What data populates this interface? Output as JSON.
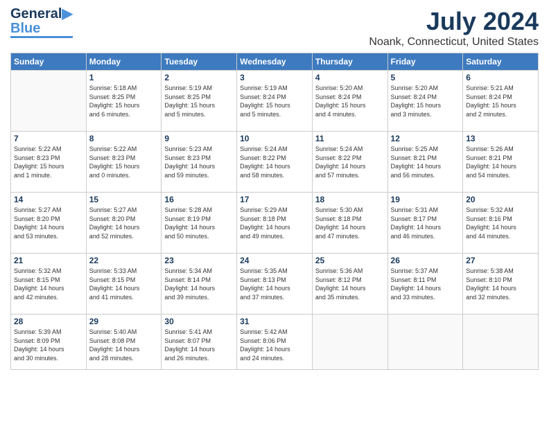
{
  "header": {
    "logo_line1": "General",
    "logo_line2": "Blue",
    "main_title": "July 2024",
    "subtitle": "Noank, Connecticut, United States"
  },
  "calendar": {
    "days_of_week": [
      "Sunday",
      "Monday",
      "Tuesday",
      "Wednesday",
      "Thursday",
      "Friday",
      "Saturday"
    ],
    "weeks": [
      [
        {
          "day": "",
          "info": ""
        },
        {
          "day": "1",
          "info": "Sunrise: 5:18 AM\nSunset: 8:25 PM\nDaylight: 15 hours\nand 6 minutes."
        },
        {
          "day": "2",
          "info": "Sunrise: 5:19 AM\nSunset: 8:25 PM\nDaylight: 15 hours\nand 5 minutes."
        },
        {
          "day": "3",
          "info": "Sunrise: 5:19 AM\nSunset: 8:24 PM\nDaylight: 15 hours\nand 5 minutes."
        },
        {
          "day": "4",
          "info": "Sunrise: 5:20 AM\nSunset: 8:24 PM\nDaylight: 15 hours\nand 4 minutes."
        },
        {
          "day": "5",
          "info": "Sunrise: 5:20 AM\nSunset: 8:24 PM\nDaylight: 15 hours\nand 3 minutes."
        },
        {
          "day": "6",
          "info": "Sunrise: 5:21 AM\nSunset: 8:24 PM\nDaylight: 15 hours\nand 2 minutes."
        }
      ],
      [
        {
          "day": "7",
          "info": "Sunrise: 5:22 AM\nSunset: 8:23 PM\nDaylight: 15 hours\nand 1 minute."
        },
        {
          "day": "8",
          "info": "Sunrise: 5:22 AM\nSunset: 8:23 PM\nDaylight: 15 hours\nand 0 minutes."
        },
        {
          "day": "9",
          "info": "Sunrise: 5:23 AM\nSunset: 8:23 PM\nDaylight: 14 hours\nand 59 minutes."
        },
        {
          "day": "10",
          "info": "Sunrise: 5:24 AM\nSunset: 8:22 PM\nDaylight: 14 hours\nand 58 minutes."
        },
        {
          "day": "11",
          "info": "Sunrise: 5:24 AM\nSunset: 8:22 PM\nDaylight: 14 hours\nand 57 minutes."
        },
        {
          "day": "12",
          "info": "Sunrise: 5:25 AM\nSunset: 8:21 PM\nDaylight: 14 hours\nand 56 minutes."
        },
        {
          "day": "13",
          "info": "Sunrise: 5:26 AM\nSunset: 8:21 PM\nDaylight: 14 hours\nand 54 minutes."
        }
      ],
      [
        {
          "day": "14",
          "info": "Sunrise: 5:27 AM\nSunset: 8:20 PM\nDaylight: 14 hours\nand 53 minutes."
        },
        {
          "day": "15",
          "info": "Sunrise: 5:27 AM\nSunset: 8:20 PM\nDaylight: 14 hours\nand 52 minutes."
        },
        {
          "day": "16",
          "info": "Sunrise: 5:28 AM\nSunset: 8:19 PM\nDaylight: 14 hours\nand 50 minutes."
        },
        {
          "day": "17",
          "info": "Sunrise: 5:29 AM\nSunset: 8:18 PM\nDaylight: 14 hours\nand 49 minutes."
        },
        {
          "day": "18",
          "info": "Sunrise: 5:30 AM\nSunset: 8:18 PM\nDaylight: 14 hours\nand 47 minutes."
        },
        {
          "day": "19",
          "info": "Sunrise: 5:31 AM\nSunset: 8:17 PM\nDaylight: 14 hours\nand 46 minutes."
        },
        {
          "day": "20",
          "info": "Sunrise: 5:32 AM\nSunset: 8:16 PM\nDaylight: 14 hours\nand 44 minutes."
        }
      ],
      [
        {
          "day": "21",
          "info": "Sunrise: 5:32 AM\nSunset: 8:15 PM\nDaylight: 14 hours\nand 42 minutes."
        },
        {
          "day": "22",
          "info": "Sunrise: 5:33 AM\nSunset: 8:15 PM\nDaylight: 14 hours\nand 41 minutes."
        },
        {
          "day": "23",
          "info": "Sunrise: 5:34 AM\nSunset: 8:14 PM\nDaylight: 14 hours\nand 39 minutes."
        },
        {
          "day": "24",
          "info": "Sunrise: 5:35 AM\nSunset: 8:13 PM\nDaylight: 14 hours\nand 37 minutes."
        },
        {
          "day": "25",
          "info": "Sunrise: 5:36 AM\nSunset: 8:12 PM\nDaylight: 14 hours\nand 35 minutes."
        },
        {
          "day": "26",
          "info": "Sunrise: 5:37 AM\nSunset: 8:11 PM\nDaylight: 14 hours\nand 33 minutes."
        },
        {
          "day": "27",
          "info": "Sunrise: 5:38 AM\nSunset: 8:10 PM\nDaylight: 14 hours\nand 32 minutes."
        }
      ],
      [
        {
          "day": "28",
          "info": "Sunrise: 5:39 AM\nSunset: 8:09 PM\nDaylight: 14 hours\nand 30 minutes."
        },
        {
          "day": "29",
          "info": "Sunrise: 5:40 AM\nSunset: 8:08 PM\nDaylight: 14 hours\nand 28 minutes."
        },
        {
          "day": "30",
          "info": "Sunrise: 5:41 AM\nSunset: 8:07 PM\nDaylight: 14 hours\nand 26 minutes."
        },
        {
          "day": "31",
          "info": "Sunrise: 5:42 AM\nSunset: 8:06 PM\nDaylight: 14 hours\nand 24 minutes."
        },
        {
          "day": "",
          "info": ""
        },
        {
          "day": "",
          "info": ""
        },
        {
          "day": "",
          "info": ""
        }
      ]
    ]
  }
}
